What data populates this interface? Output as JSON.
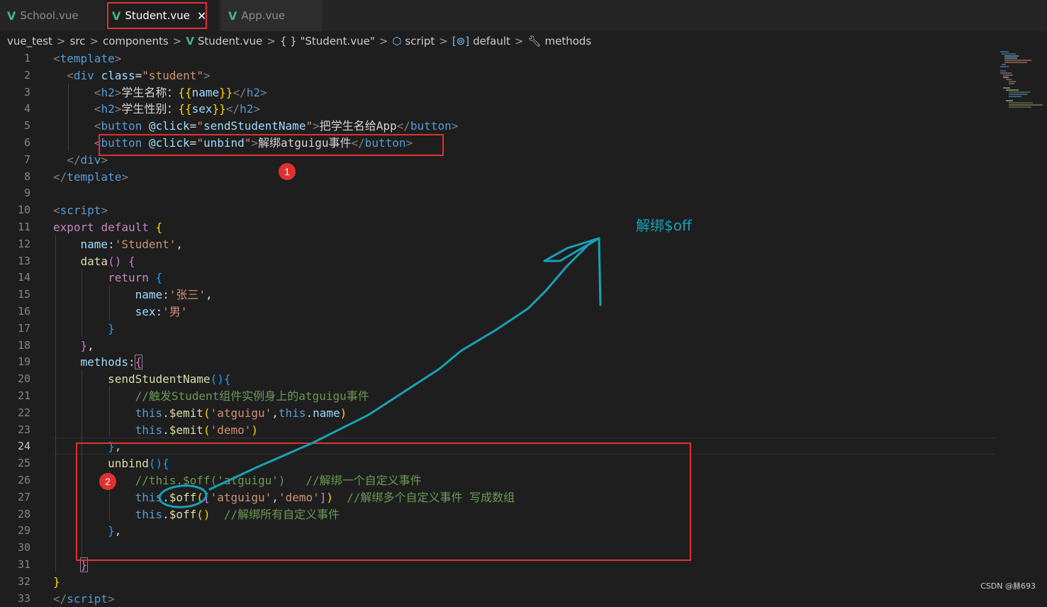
{
  "tabs": [
    {
      "label": "School.vue",
      "icon": "vue-icon"
    },
    {
      "label": "Student.vue",
      "icon": "vue-icon",
      "close": "✕"
    },
    {
      "label": "App.vue",
      "icon": "vue-icon"
    }
  ],
  "breadcrumb": {
    "items": [
      "vue_test",
      "src",
      "components",
      "Student.vue",
      "{ } \"Student.vue\"",
      "script",
      "default",
      "methods"
    ]
  },
  "line_numbers": [
    "1",
    "2",
    "3",
    "4",
    "5",
    "6",
    "7",
    "8",
    "9",
    "10",
    "11",
    "12",
    "13",
    "14",
    "15",
    "16",
    "17",
    "18",
    "19",
    "20",
    "21",
    "22",
    "23",
    "24",
    "25",
    "26",
    "27",
    "28",
    "29",
    "30",
    "31",
    "32",
    "33"
  ],
  "current_line": "24",
  "annotations": {
    "badge1": "1",
    "badge2": "2",
    "arrow_text": "解绑$off"
  },
  "watermark": "CSDN @赫693",
  "colors": {
    "annotation_red": "#e03131",
    "annotation_teal": "#17a2b8",
    "vue_green": "#41b883"
  }
}
